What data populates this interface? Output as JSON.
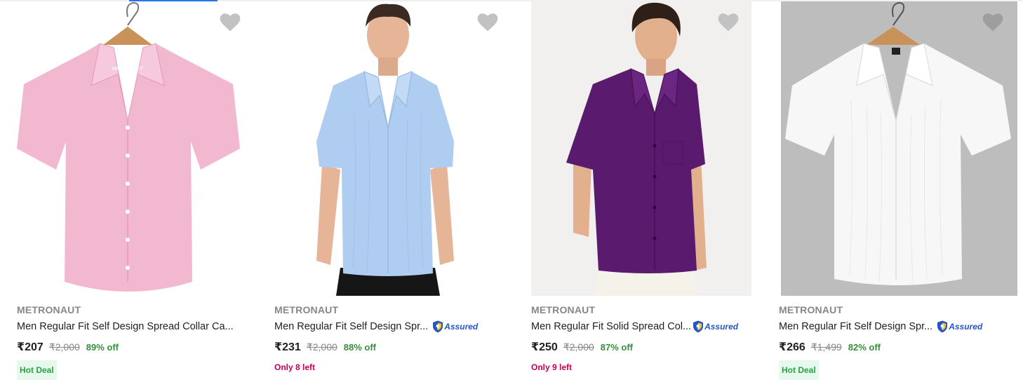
{
  "products": [
    {
      "brand": "METRONAUT",
      "title": "Men Regular Fit Self Design Spread Collar Ca...",
      "assured": false,
      "price": "₹207",
      "mrp": "₹2,000",
      "discount": "89% off",
      "badge": "Hot Deal",
      "stock_note": "",
      "shirt_color": "#f2b8cf",
      "image_label": "METRONAUT"
    },
    {
      "brand": "METRONAUT",
      "title": "Men Regular Fit Self Design Spr...",
      "assured": true,
      "price": "₹231",
      "mrp": "₹2,000",
      "discount": "88% off",
      "badge": "",
      "stock_note": "Only 8 left",
      "shirt_color": "#aecdf0"
    },
    {
      "brand": "METRONAUT",
      "title": "Men Regular Fit Solid Spread Col...",
      "assured": true,
      "price": "₹250",
      "mrp": "₹2,000",
      "discount": "87% off",
      "badge": "",
      "stock_note": "Only 9 left",
      "shirt_color": "#5a1a6e"
    },
    {
      "brand": "METRONAUT",
      "title": "Men Regular Fit Self Design Spr...",
      "assured": true,
      "price": "₹266",
      "mrp": "₹1,499",
      "discount": "82% off",
      "badge": "Hot Deal",
      "stock_note": "",
      "shirt_color": "#f7f7f7"
    }
  ],
  "assured_label": "Assured",
  "colors": {
    "discount": "#388e3c",
    "stock_note": "#c70055",
    "badge_text": "#26a541",
    "badge_bg": "#e7f8ec",
    "assured": "#2455c3",
    "wishlist": "#c2c2c2"
  },
  "icons": {
    "wishlist": "heart-icon",
    "assured": "assured-shield-icon"
  }
}
